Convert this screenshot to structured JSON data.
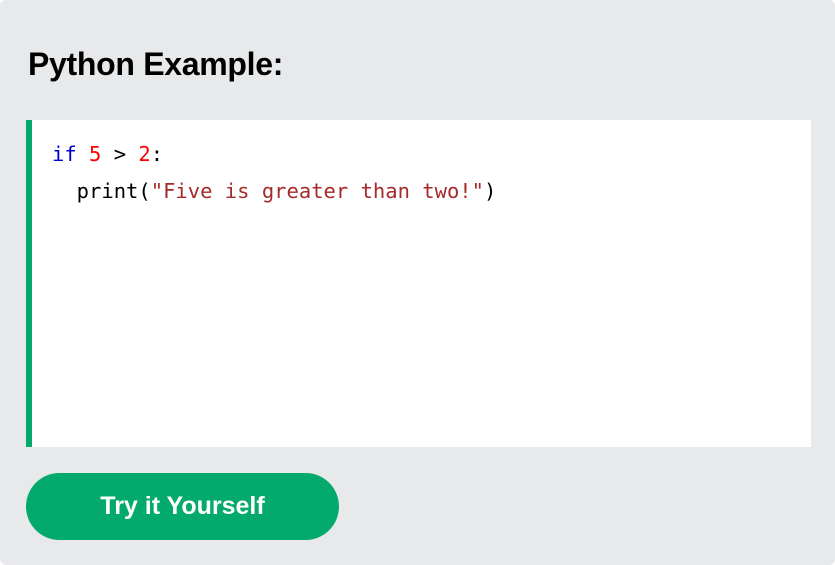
{
  "heading": "Python Example:",
  "code": {
    "line1": {
      "kw": "if",
      "sp1": " ",
      "n1": "5",
      "op": " > ",
      "n2": "2",
      "colon": ":"
    },
    "line2": {
      "fn": "  print(",
      "str": "\"Five is greater than two!\"",
      "close": ")"
    }
  },
  "button_label": "Try it Yourself",
  "colors": {
    "accent": "#04aa6d",
    "keyword": "#0000cd",
    "number": "#ff0000",
    "string": "#a52a2a",
    "background": "#e7e9eb"
  }
}
